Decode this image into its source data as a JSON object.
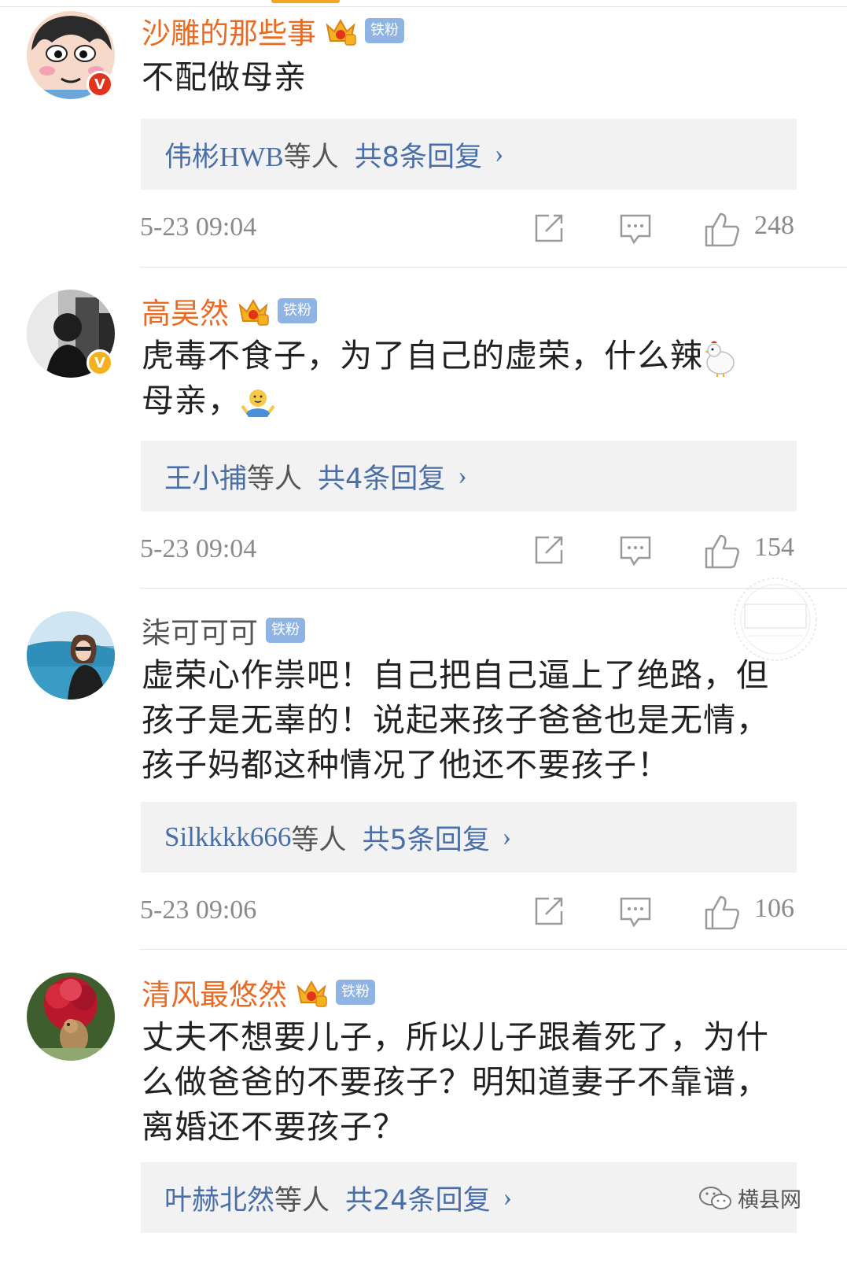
{
  "comments": [
    {
      "username": "沙雕的那些事",
      "fan_badge": "铁粉",
      "verified": "V",
      "content": "不配做母亲",
      "reply_users": "伟彬HWB",
      "reply_etc": "等人",
      "reply_count": "共8条回复",
      "time": "5-23 09:04",
      "likes": "248"
    },
    {
      "username": "高昊然",
      "fan_badge": "铁粉",
      "verified": "V",
      "content_line1": "虎毒不食子，为了自己的虚荣，什么辣",
      "content_line2": "母亲，",
      "reply_users": "王小捕",
      "reply_etc": "等人",
      "reply_count": "共4条回复",
      "time": "5-23 09:04",
      "likes": "154"
    },
    {
      "username": "柒可可可",
      "fan_badge": "铁粉",
      "content_line1": "虚荣心作祟吧！自己把自己逼上了绝路，但",
      "content_line2": "孩子是无辜的！说起来孩子爸爸也是无情，",
      "content_line3": "孩子妈都这种情况了他还不要孩子！",
      "reply_users": "Silkkkk666",
      "reply_etc": "等人",
      "reply_count": "共5条回复",
      "time": "5-23 09:06",
      "likes": "106"
    },
    {
      "username": "清风最悠然",
      "fan_badge": "铁粉",
      "content_line1": "丈夫不想要儿子，所以儿子跟着死了，为什",
      "content_line2": "么做爸爸的不要孩子？明知道妻子不靠谱，",
      "content_line3": "离婚还不要孩子？",
      "reply_users": "叶赫北然",
      "reply_etc": "等人",
      "reply_count": "共24条回复"
    }
  ],
  "chevron": "›",
  "watermark_text": "横县网",
  "icons": {
    "repost": "repost-icon",
    "comment": "comment-icon",
    "like": "thumbs-up-icon",
    "crown": "crown-icon",
    "wechat": "wechat-icon"
  },
  "colors": {
    "username_orange": "#e86b24",
    "link_blue": "#4a6fa8",
    "fan_badge_bg": "#8fb4e4",
    "meta_gray": "#8a8a8a"
  }
}
